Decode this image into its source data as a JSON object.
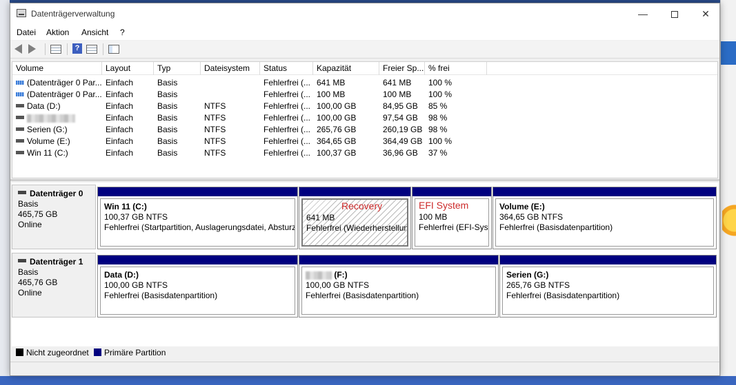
{
  "window": {
    "title": "Datenträgerverwaltung"
  },
  "menu": [
    "Datei",
    "Aktion",
    "Ansicht",
    "?"
  ],
  "columns": [
    "Volume",
    "Layout",
    "Typ",
    "Dateisystem",
    "Status",
    "Kapazität",
    "Freier Sp...",
    "% frei"
  ],
  "volumes": [
    {
      "volume": "(Datenträger 0 Par...",
      "layout": "Einfach",
      "typ": "Basis",
      "fs": "",
      "status": "Fehlerfrei (...",
      "kapazitaet": "641 MB",
      "frei": "641 MB",
      "prozent": "100 %",
      "icon": "system-volume-icon"
    },
    {
      "volume": "(Datenträger 0 Par...",
      "layout": "Einfach",
      "typ": "Basis",
      "fs": "",
      "status": "Fehlerfrei (...",
      "kapazitaet": "100 MB",
      "frei": "100 MB",
      "prozent": "100 %",
      "icon": "system-volume-icon"
    },
    {
      "volume": "Data (D:)",
      "layout": "Einfach",
      "typ": "Basis",
      "fs": "NTFS",
      "status": "Fehlerfrei (...",
      "kapazitaet": "100,00 GB",
      "frei": "84,95 GB",
      "prozent": "85 %",
      "icon": "volume-icon"
    },
    {
      "volume": "",
      "layout": "Einfach",
      "typ": "Basis",
      "fs": "NTFS",
      "status": "Fehlerfrei (...",
      "kapazitaet": "100,00 GB",
      "frei": "97,54 GB",
      "prozent": "98 %",
      "icon": "volume-icon"
    },
    {
      "volume": "Serien (G:)",
      "layout": "Einfach",
      "typ": "Basis",
      "fs": "NTFS",
      "status": "Fehlerfrei (...",
      "kapazitaet": "265,76 GB",
      "frei": "260,19 GB",
      "prozent": "98 %",
      "icon": "volume-icon"
    },
    {
      "volume": "Volume (E:)",
      "layout": "Einfach",
      "typ": "Basis",
      "fs": "NTFS",
      "status": "Fehlerfrei (...",
      "kapazitaet": "364,65 GB",
      "frei": "364,49 GB",
      "prozent": "100 %",
      "icon": "volume-icon"
    },
    {
      "volume": "Win 11 (C:)",
      "layout": "Einfach",
      "typ": "Basis",
      "fs": "NTFS",
      "status": "Fehlerfrei (...",
      "kapazitaet": "100,37 GB",
      "frei": "36,96 GB",
      "prozent": "37 %",
      "icon": "volume-icon"
    }
  ],
  "disks": [
    {
      "name": "Datenträger 0",
      "type": "Basis",
      "size": "465,75 GB",
      "state": "Online",
      "partitions": [
        {
          "title": "Win 11  (C:)",
          "size": "100,37 GB NTFS",
          "status": "Fehlerfrei (Startpartition, Auslagerungsdatei, Absturz",
          "ghost": ""
        },
        {
          "title": "",
          "size": "641 MB",
          "status": "Fehlerfrei (Wiederherstellung",
          "ghost": "Recovery"
        },
        {
          "title": "",
          "size": "100 MB",
          "status": "Fehlerfrei (EFI-Syste",
          "ghost": "EFI System"
        },
        {
          "title": "Volume  (E:)",
          "size": "364,65 GB NTFS",
          "status": "Fehlerfrei (Basisdatenpartition)",
          "ghost": ""
        }
      ]
    },
    {
      "name": "Datenträger 1",
      "type": "Basis",
      "size": "465,76 GB",
      "state": "Online",
      "partitions": [
        {
          "title": "Data  (D:)",
          "size": "100,00 GB NTFS",
          "status": "Fehlerfrei (Basisdatenpartition)"
        },
        {
          "title": "(F:)",
          "size": "100,00 GB NTFS",
          "status": "Fehlerfrei (Basisdatenpartition)"
        },
        {
          "title": "Serien  (G:)",
          "size": "265,76 GB NTFS",
          "status": "Fehlerfrei (Basisdatenpartition)"
        }
      ]
    }
  ],
  "legend": [
    {
      "label": "Nicht zugeordnet",
      "color": "#000000"
    },
    {
      "label": "Primäre Partition",
      "color": "#00007f"
    }
  ],
  "colors": {
    "primary_partition": "#00007f",
    "unallocated": "#000000",
    "ghost_text": "#cc2a2a"
  }
}
